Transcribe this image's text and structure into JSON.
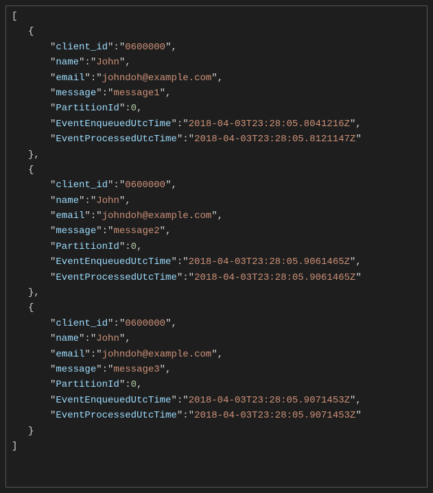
{
  "records": [
    {
      "client_id": "0600000",
      "name": "John",
      "email": "johndoh@example.com",
      "message": "message1",
      "PartitionId": 0,
      "EventEnqueuedUtcTime": "2018-04-03T23:28:05.8041216Z",
      "EventProcessedUtcTime": "2018-04-03T23:28:05.8121147Z"
    },
    {
      "client_id": "0600000",
      "name": "John",
      "email": "johndoh@example.com",
      "message": "message2",
      "PartitionId": 0,
      "EventEnqueuedUtcTime": "2018-04-03T23:28:05.9061465Z",
      "EventProcessedUtcTime": "2018-04-03T23:28:05.9061465Z"
    },
    {
      "client_id": "0600000",
      "name": "John",
      "email": "johndoh@example.com",
      "message": "message3",
      "PartitionId": 0,
      "EventEnqueuedUtcTime": "2018-04-03T23:28:05.9071453Z",
      "EventProcessedUtcTime": "2018-04-03T23:28:05.9071453Z"
    }
  ],
  "keys": {
    "client_id": "client_id",
    "name": "name",
    "email": "email",
    "message": "message",
    "PartitionId": "PartitionId",
    "EventEnqueuedUtcTime": "EventEnqueuedUtcTime",
    "EventProcessedUtcTime": "EventProcessedUtcTime"
  }
}
